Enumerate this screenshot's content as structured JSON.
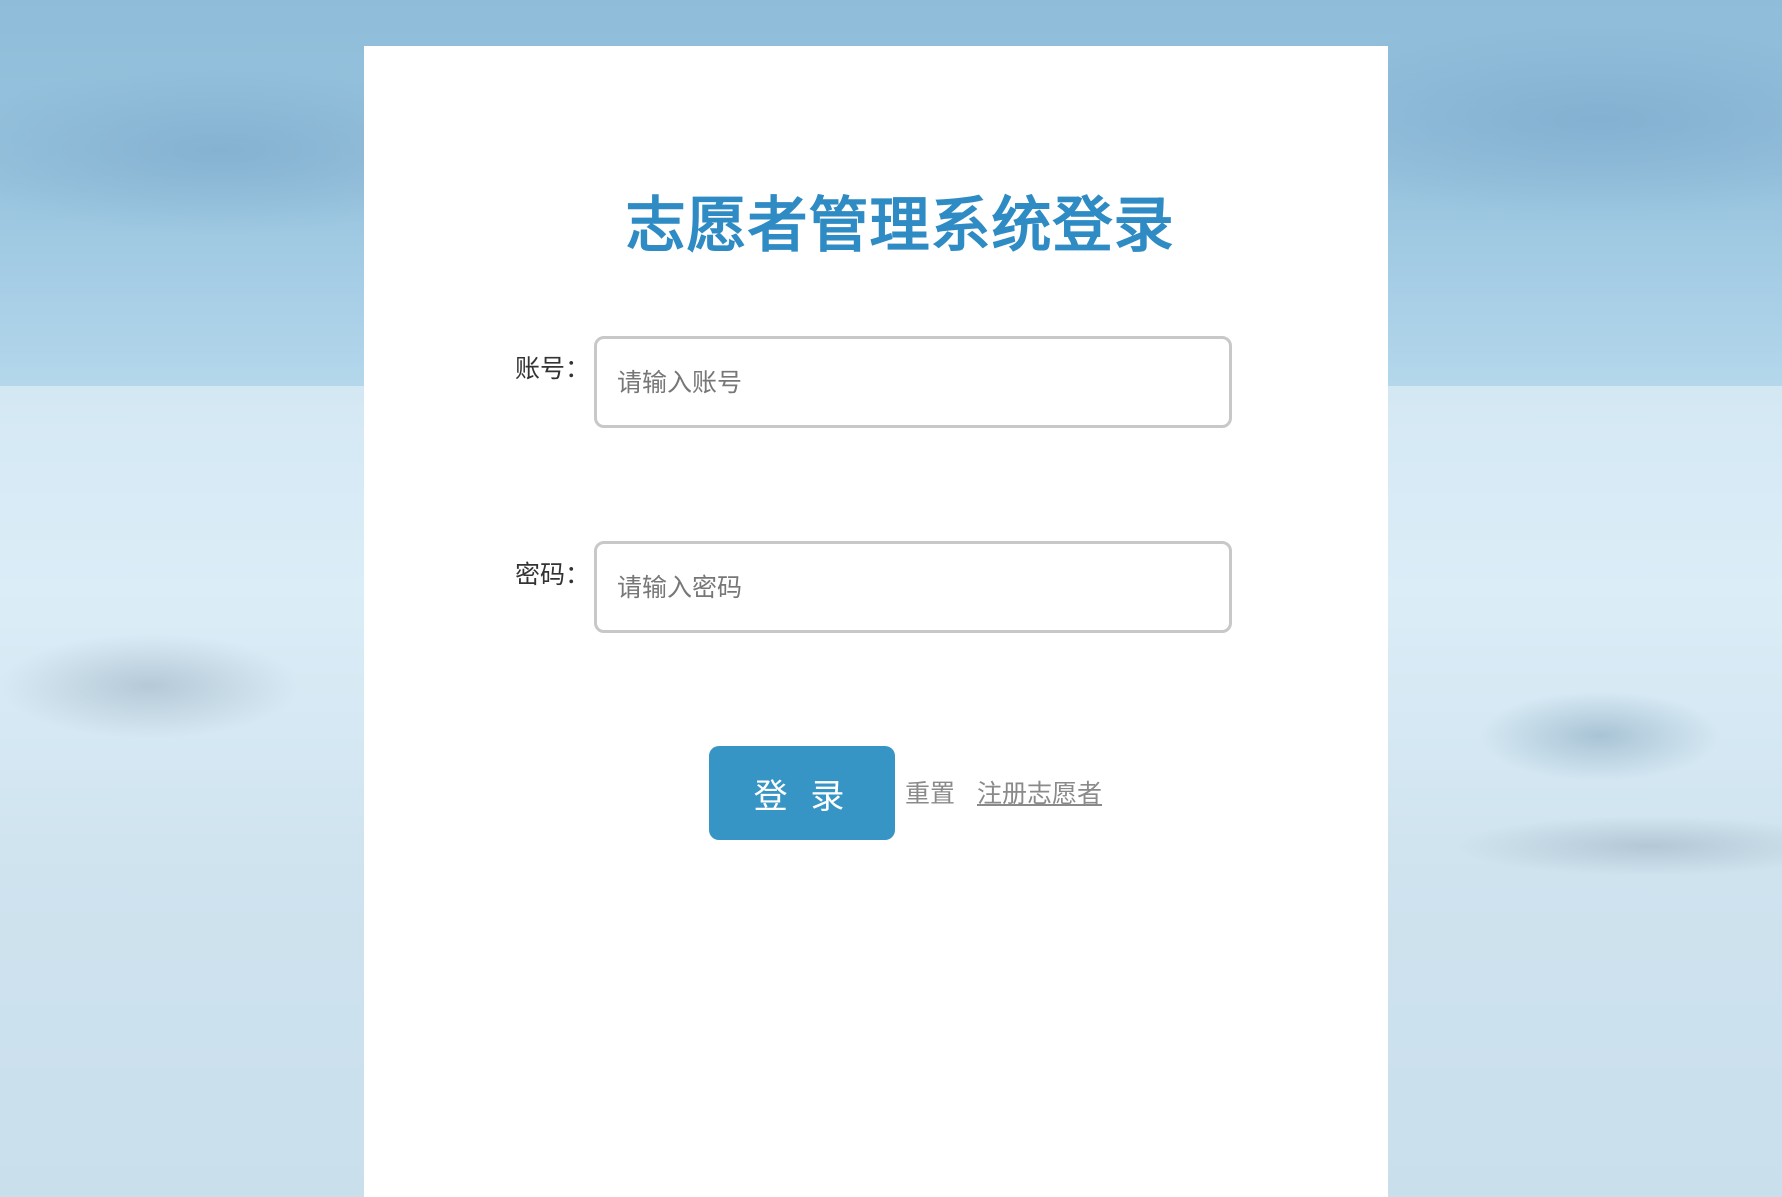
{
  "login": {
    "title": "志愿者管理系统登录",
    "account_label": "账号：",
    "account_placeholder": "请输入账号",
    "password_label": "密码：",
    "password_placeholder": "请输入密码",
    "login_button_label": "登 录",
    "reset_label": "重置",
    "register_label": "注册志愿者"
  },
  "colors": {
    "title": "#2e8bc4",
    "login_button": "#3795c6",
    "link": "#8a8a8a",
    "input_border": "#c8c8c8"
  }
}
